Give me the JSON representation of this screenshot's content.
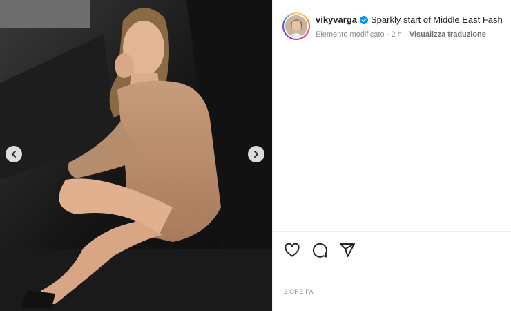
{
  "media": {
    "description_icon": "photo",
    "prev_icon": "chevron-left-icon",
    "next_icon": "chevron-right-icon"
  },
  "post": {
    "username": "vikyvarga",
    "verified_icon": "verified-badge-icon",
    "caption": "Sparkly start of Middle East Fash",
    "edited_label": "Elemento modificato",
    "separator": "·",
    "age": "2 h",
    "translate_label": "Visualizza traduzione",
    "timestamp": "2 ORE FA"
  },
  "actions": {
    "like_icon": "heart-icon",
    "comment_icon": "comment-icon",
    "share_icon": "send-icon"
  },
  "colors": {
    "verified": "#0095f6",
    "text": "#262626",
    "muted": "#8e8e8e"
  }
}
